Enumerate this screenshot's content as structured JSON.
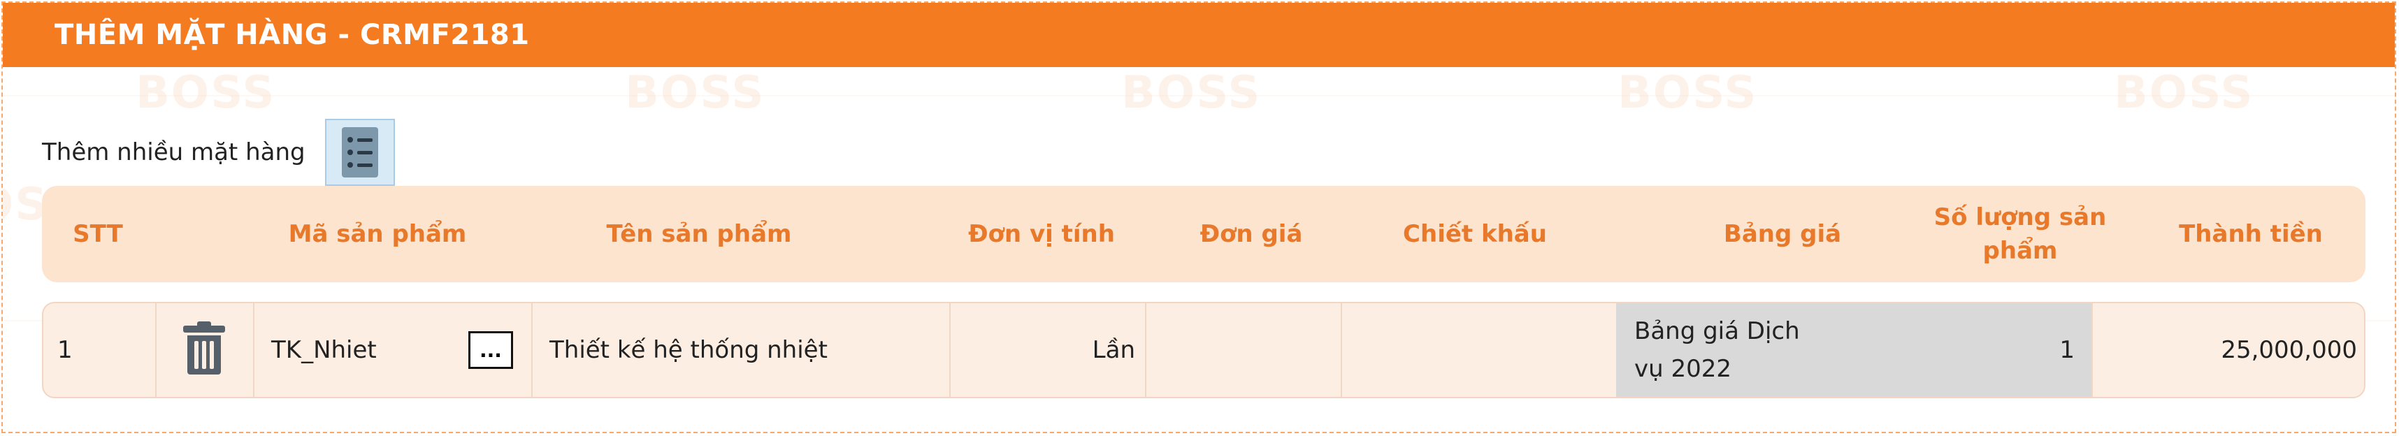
{
  "header": {
    "title": "THÊM MẶT HÀNG - CRMF2181"
  },
  "watermark": {
    "text": "BOSS"
  },
  "toolbar": {
    "add_multiple_label": "Thêm nhiều mặt hàng"
  },
  "table": {
    "columns": [
      "STT",
      "Mã sản phẩm",
      "Tên sản phẩm",
      "Đơn vị tính",
      "Đơn giá",
      "Chiết khấu",
      "Bảng giá",
      "Số lượng sản phẩm",
      "Thành tiền"
    ],
    "rows": [
      {
        "stt": "1",
        "product_code": "TK_Nhiet",
        "more_label": "...",
        "product_name": "Thiết kế hệ thống nhiệt",
        "unit": "Lần",
        "unit_price": "",
        "discount": "",
        "price_list": "Bảng giá Dịch vụ 2022",
        "quantity": "1",
        "amount": "25,000,000"
      }
    ]
  },
  "colors": {
    "accent": "#f47b20",
    "header_row": "#fde4cf",
    "row_bg": "#fdeee3",
    "price_cell": "#d9d9d9"
  }
}
